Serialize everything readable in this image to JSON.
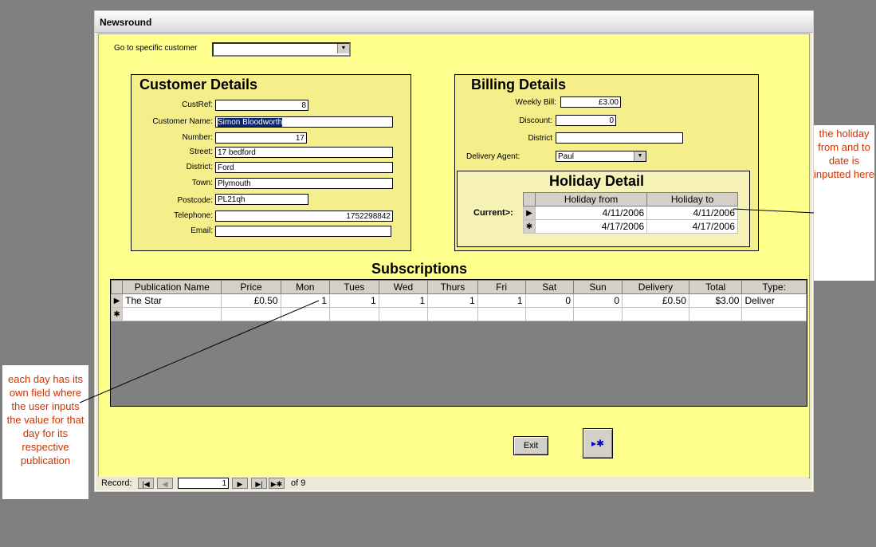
{
  "window": {
    "title": "Newsround"
  },
  "goto": {
    "label": "Go to specific customer",
    "value": ""
  },
  "customer": {
    "title": "Customer Details",
    "fields": [
      {
        "label": "CustRef:",
        "value": "8"
      },
      {
        "label": "Customer Name:",
        "value": "Simon Bloodworth"
      },
      {
        "label": "Number:",
        "value": "17"
      },
      {
        "label": "Street:",
        "value": "17 bedford"
      },
      {
        "label": "District:",
        "value": "Ford"
      },
      {
        "label": "Town:",
        "value": "Plymouth"
      },
      {
        "label": "Postcode:",
        "value": "PL21qh"
      },
      {
        "label": "Telephone:",
        "value": "1752298842"
      },
      {
        "label": "Email:",
        "value": ""
      }
    ]
  },
  "billing": {
    "title": "Billing Details",
    "weekly_bill_label": "Weekly Bill:",
    "weekly_bill": "£3.00",
    "discount_label": "Discount:",
    "discount": "0",
    "district_label": "District",
    "district": "",
    "agent_label": "Delivery Agent:",
    "agent": "Paul"
  },
  "holiday": {
    "title": "Holiday Detail",
    "current_label": "Current>:",
    "columns": [
      "Holiday from",
      "Holiday to"
    ],
    "rows": [
      [
        "4/11/2006",
        "4/11/2006"
      ],
      [
        "4/17/2006",
        "4/17/2006"
      ]
    ]
  },
  "subscriptions": {
    "title": "Subscriptions",
    "columns": [
      "Publication Name",
      "Price",
      "Mon",
      "Tues",
      "Wed",
      "Thurs",
      "Fri",
      "Sat",
      "Sun",
      "Delivery",
      "Total",
      "Type:"
    ],
    "row": [
      "The Star",
      "£0.50",
      "1",
      "1",
      "1",
      "1",
      "1",
      "0",
      "0",
      "£0.50",
      "$3.00",
      "Deliver"
    ]
  },
  "buttons": {
    "exit": "Exit"
  },
  "record": {
    "label": "Record:",
    "current": "1",
    "of_text": "of  9"
  },
  "notes": {
    "right": "the holiday from and to date is inputted here",
    "left": "each day has its own field where the user inputs the value for that day for its respective publication"
  },
  "colors": {
    "form_bg": "#ffff8e",
    "panel_bg": "#f4ef8a",
    "annotation": "#cc3300",
    "desktop": "#808080"
  }
}
